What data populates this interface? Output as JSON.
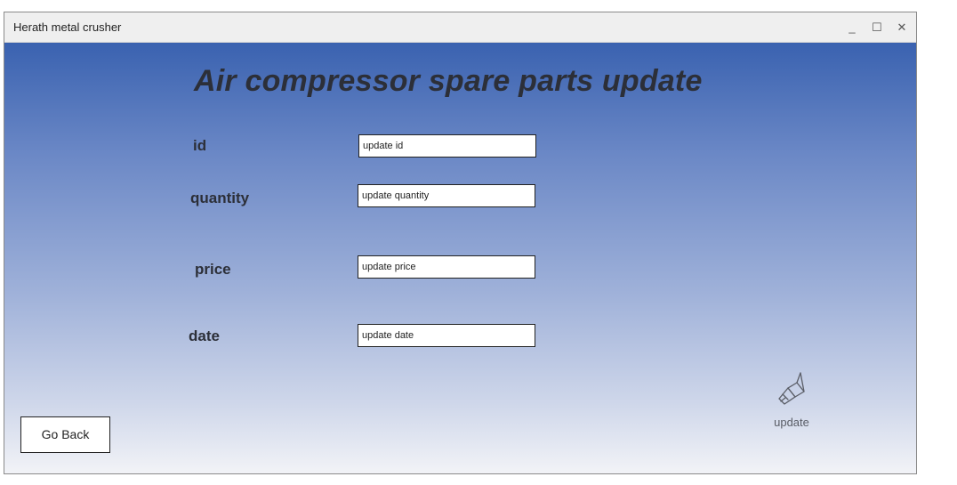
{
  "window": {
    "title": "Herath metal crusher",
    "controls": {
      "minimize": "_",
      "maximize": "☐",
      "close": "✕"
    }
  },
  "form": {
    "title": "Air compressor spare parts update",
    "fields": [
      {
        "label": "id",
        "placeholder": "update id"
      },
      {
        "label": "quantity",
        "placeholder": "update quantity"
      },
      {
        "label": "price",
        "placeholder": "update price"
      },
      {
        "label": "date",
        "placeholder": "update date"
      }
    ]
  },
  "buttons": {
    "go_back": "Go Back",
    "update": "update",
    "update_icon": "broom-icon"
  },
  "colors": {
    "gradient_top": "#3a62b0",
    "gradient_bottom": "#f2f3f7",
    "title_text": "#2c2f38"
  }
}
